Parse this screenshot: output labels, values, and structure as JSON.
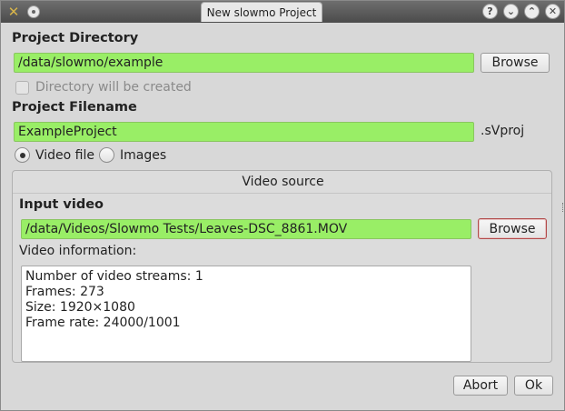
{
  "window": {
    "title": "New slowmo Project",
    "titlebar_buttons": [
      {
        "name": "help-icon",
        "glyph": "?"
      },
      {
        "name": "minimize-icon",
        "glyph": "⌄"
      },
      {
        "name": "maximize-icon",
        "glyph": "⌃"
      },
      {
        "name": "close-icon",
        "glyph": "✕"
      }
    ]
  },
  "project": {
    "directory_label": "Project Directory",
    "directory_value": "/data/slowmo/example",
    "browse_label": "Browse",
    "directory_created_label": "Directory will be created",
    "filename_label": "Project Filename",
    "filename_value": "ExampleProject",
    "filename_suffix": ".sVproj"
  },
  "source_type": {
    "video_label": "Video file",
    "images_label": "Images",
    "selected": "Video file"
  },
  "video_source": {
    "title": "Video source",
    "input_label": "Input video",
    "input_value": "/data/Videos/Slowmo Tests/Leaves-DSC_8861.MOV",
    "browse_label": "Browse",
    "info_label": "Video information:",
    "info_lines": [
      "Number of video streams: 1",
      "Frames: 273",
      "Size: 1920×1080",
      "Frame rate: 24000/1001"
    ]
  },
  "footer": {
    "abort_label": "Abort",
    "ok_label": "Ok"
  },
  "colors": {
    "valid_field": "#99ee66",
    "titlebar": "#5a5a5a",
    "focus_border": "#b24b4b"
  }
}
